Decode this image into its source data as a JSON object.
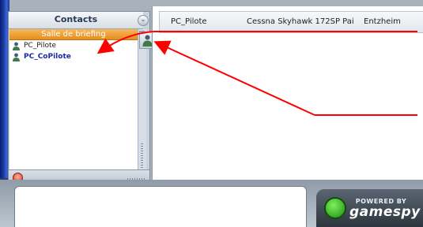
{
  "contacts": {
    "title": "Contacts",
    "collapse_glyph": "⌄",
    "group_label": "Salle de briefing",
    "items": [
      {
        "name": "PC_Pilote",
        "icon": "user-icon"
      },
      {
        "name": "PC_CoPilote",
        "icon": "user-icon"
      }
    ]
  },
  "session": {
    "player": "PC_Pilote",
    "aircraft": "Cessna Skyhawk 172SP Pai",
    "airport": "Entzheim"
  },
  "logo": {
    "powered_by": "POWERED BY",
    "brand": "gamespy"
  },
  "colors": {
    "group_orange": "#e58e1e",
    "annotation_red": "#ff0000",
    "contact_highlight": "#1b2aa8"
  }
}
